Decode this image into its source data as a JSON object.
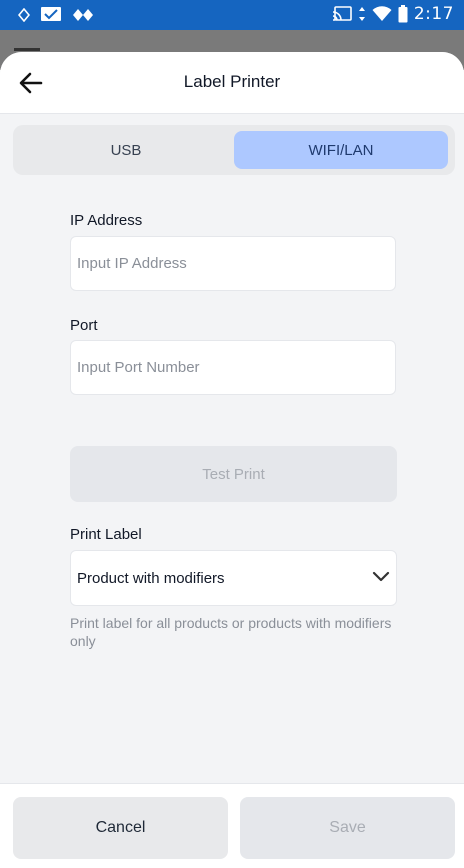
{
  "status_bar": {
    "time": "2:17",
    "left_icons": [
      "app-notification-icon",
      "checkbox-notification-icon",
      "diamond-notification-icon"
    ],
    "right_icons": [
      "cast-icon",
      "data-arrows-icon",
      "wifi-icon",
      "battery-icon"
    ],
    "color": "#1565c0"
  },
  "header": {
    "title": "Label Printer"
  },
  "tabs": [
    {
      "label": "USB",
      "active": false
    },
    {
      "label": "WIFI/LAN",
      "active": true
    }
  ],
  "form": {
    "ip_label": "IP Address",
    "ip_placeholder": "Input IP Address",
    "ip_value": "",
    "port_label": "Port",
    "port_placeholder": "Input Port Number",
    "port_value": "",
    "test_print_label": "Test Print",
    "print_label_label": "Print Label",
    "print_label_value": "Product with modifiers",
    "print_label_help": "Print label for all products or products with modifiers only"
  },
  "footer": {
    "cancel_label": "Cancel",
    "save_label": "Save"
  },
  "colors": {
    "accent_tab": "#adc8ff",
    "disabled_text": "#a9adb4"
  }
}
